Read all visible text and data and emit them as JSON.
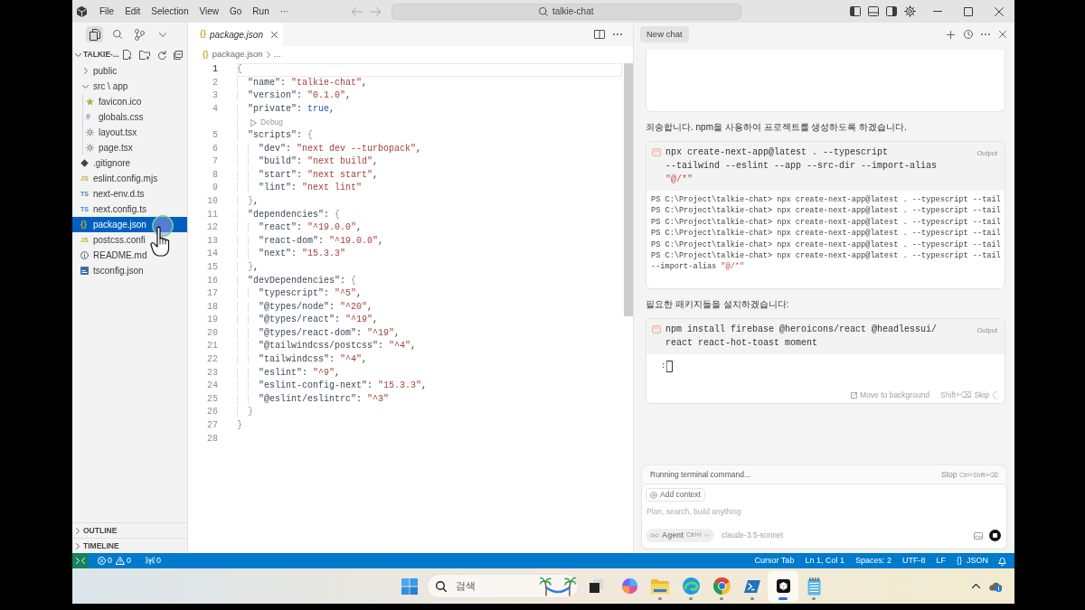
{
  "title_bar": {
    "menu": [
      "File",
      "Edit",
      "Selection",
      "View",
      "Go",
      "Run",
      "···"
    ],
    "command_center": "talkie-chat"
  },
  "activity_bar": [
    {
      "kind": "files",
      "selected": true
    },
    {
      "kind": "search",
      "selected": false
    },
    {
      "kind": "source-control",
      "selected": false
    }
  ],
  "explorer": {
    "title": "TALKIE-...",
    "expanded": true,
    "tree": [
      {
        "label": "public",
        "kind": "folder",
        "expanded": false,
        "selected": false
      },
      {
        "label": "src \\ app",
        "kind": "folder",
        "expanded": true,
        "selected": false,
        "children": [
          {
            "label": "favicon.ico",
            "kind": "star",
            "selected": false
          },
          {
            "label": "globals.css",
            "kind": "css",
            "glyph": "#",
            "selected": false
          },
          {
            "label": "layout.tsx",
            "kind": "gear",
            "selected": false
          },
          {
            "label": "page.tsx",
            "kind": "gear",
            "selected": false
          }
        ]
      },
      {
        "label": ".gitignore",
        "kind": "diamond",
        "selected": false
      },
      {
        "label": "eslint.config.mjs",
        "kind": "js",
        "glyph": "JS",
        "selected": false
      },
      {
        "label": "next-env.d.ts",
        "kind": "ts",
        "glyph": "TS",
        "selected": false
      },
      {
        "label": "next.config.ts",
        "kind": "ts",
        "glyph": "TS",
        "selected": false
      },
      {
        "label": "package.json",
        "kind": "json",
        "glyph": "{}",
        "selected": true
      },
      {
        "label": "postcss.confi",
        "kind": "js",
        "glyph": "JS",
        "selected": false
      },
      {
        "label": "README.md",
        "kind": "info",
        "selected": false
      },
      {
        "label": "tsconfig.json",
        "kind": "tsconfig",
        "selected": false
      }
    ],
    "sections": [
      {
        "label": "OUTLINE",
        "expanded": false
      },
      {
        "label": "TIMELINE",
        "expanded": false
      }
    ]
  },
  "mouse_pointer": {
    "kind": "hand",
    "click_ring": true
  },
  "editor": {
    "tabs": [
      {
        "glyph": "{}",
        "label": "package.json",
        "preview": true,
        "selected": true
      }
    ],
    "breadcrumb": [
      {
        "glyph": "{}",
        "label": "package.json"
      },
      {
        "label": "..."
      }
    ],
    "lines": [
      {
        "kind": "code",
        "number": "1",
        "text": "{",
        "current": true
      },
      {
        "kind": "code",
        "number": "2",
        "text": "  \"name\": \"talkie-chat\",",
        "current": false
      },
      {
        "kind": "code",
        "number": "3",
        "text": "  \"version\": \"0.1.0\",",
        "current": false
      },
      {
        "kind": "code",
        "number": "4",
        "text": "  \"private\": true,",
        "current": false
      },
      {
        "kind": "codelens",
        "text": "Debug"
      },
      {
        "kind": "code",
        "number": "5",
        "text": "  \"scripts\": {",
        "current": false
      },
      {
        "kind": "code",
        "number": "6",
        "text": "    \"dev\": \"next dev --turbopack\",",
        "current": false
      },
      {
        "kind": "code",
        "number": "7",
        "text": "    \"build\": \"next build\",",
        "current": false
      },
      {
        "kind": "code",
        "number": "8",
        "text": "    \"start\": \"next start\",",
        "current": false
      },
      {
        "kind": "code",
        "number": "9",
        "text": "    \"lint\": \"next lint\"",
        "current": false
      },
      {
        "kind": "code",
        "number": "10",
        "text": "  },",
        "current": false
      },
      {
        "kind": "code",
        "number": "11",
        "text": "  \"dependencies\": {",
        "current": false
      },
      {
        "kind": "code",
        "number": "12",
        "text": "    \"react\": \"^19.0.0\",",
        "current": false
      },
      {
        "kind": "code",
        "number": "13",
        "text": "    \"react-dom\": \"^19.0.0\",",
        "current": false
      },
      {
        "kind": "code",
        "number": "14",
        "text": "    \"next\": \"15.3.3\"",
        "current": false
      },
      {
        "kind": "code",
        "number": "15",
        "text": "  },",
        "current": false
      },
      {
        "kind": "code",
        "number": "16",
        "text": "  \"devDependencies\": {",
        "current": false
      },
      {
        "kind": "code",
        "number": "17",
        "text": "    \"typescript\": \"^5\",",
        "current": false
      },
      {
        "kind": "code",
        "number": "18",
        "text": "    \"@types/node\": \"^20\",",
        "current": false
      },
      {
        "kind": "code",
        "number": "19",
        "text": "    \"@types/react\": \"^19\",",
        "current": false
      },
      {
        "kind": "code",
        "number": "20",
        "text": "    \"@types/react-dom\": \"^19\",",
        "current": false
      },
      {
        "kind": "code",
        "number": "21",
        "text": "    \"@tailwindcss/postcss\": \"^4\",",
        "current": false
      },
      {
        "kind": "code",
        "number": "22",
        "text": "    \"tailwindcss\": \"^4\",",
        "current": false
      },
      {
        "kind": "code",
        "number": "23",
        "text": "    \"eslint\": \"^9\",",
        "current": false
      },
      {
        "kind": "code",
        "number": "24",
        "text": "    \"eslint-config-next\": \"15.3.3\",",
        "current": false
      },
      {
        "kind": "code",
        "number": "25",
        "text": "    \"@eslint/eslintrc\": \"^3\"",
        "current": false
      },
      {
        "kind": "code",
        "number": "26",
        "text": "  }",
        "current": false
      },
      {
        "kind": "code",
        "number": "27",
        "text": "}",
        "current": false
      },
      {
        "kind": "code",
        "number": "28",
        "current": false
      }
    ]
  },
  "chat": {
    "tabs": [
      {
        "label": "New chat",
        "selected": true
      }
    ],
    "messages": [
      {
        "kind": "clipped-card"
      },
      {
        "kind": "text",
        "text": "죄송합니다. npm을 사용하여 프로젝트를 생성하도록 하겠습니다."
      },
      {
        "kind": "command",
        "command_lines": [
          "npx create-next-app@latest . --typescript",
          "--tailwind --eslint --app --src-dir --import-alias",
          "\"@/*\""
        ],
        "output_label": "Output",
        "output_lines": [
          "PS C:\\Project\\talkie-chat> npx create-next-app@latest . --typescript --tail",
          "PS C:\\Project\\talkie-chat> npx create-next-app@latest . --typescript --tail",
          "PS C:\\Project\\talkie-chat> npx create-next-app@latest . --typescript --tail",
          "PS C:\\Project\\talkie-chat> npx create-next-app@latest . --typescript --tail",
          "PS C:\\Project\\talkie-chat> npx create-next-app@latest . --typescript --tail",
          "PS C:\\Project\\talkie-chat> npx create-next-app@latest . --typescript --tail",
          "--import-alias \"@/*\""
        ]
      },
      {
        "kind": "text",
        "text": "필요한 패키지들을 설치하겠습니다:"
      },
      {
        "kind": "command",
        "command_lines": [
          "npm install firebase @heroicons/react @headlessui/",
          "react react-hot-toast moment"
        ],
        "output_label": "Output",
        "prompt": ":",
        "actions": {
          "background": "Move to background",
          "skip_shortcut": "Shift+⌫",
          "skip": "Skip"
        }
      }
    ],
    "run_status": {
      "text": "Running terminal command...",
      "stop": "Stop",
      "stop_shortcut": "Ctrl+Shift+⌫"
    },
    "composer": {
      "context_chip": "Add context",
      "placeholder": "Plan, search, build anything",
      "mode": "Agent",
      "mode_shortcut": "Ctrl+I",
      "model": "claude-3.5-sonnet"
    }
  },
  "status_bar": {
    "problems": {
      "errors": "0",
      "warnings": "0"
    },
    "ports": "0",
    "items": [
      {
        "label": "Cursor Tab"
      },
      {
        "label": "Ln 1, Col 1"
      },
      {
        "label": "Spaces: 2"
      },
      {
        "label": "UTF-8"
      },
      {
        "label": "LF"
      },
      {
        "glyph": "{}",
        "label": "JSON"
      }
    ]
  },
  "taskbar": {
    "search": {
      "placeholder": "검색"
    },
    "apps": [
      {
        "kind": "task-view",
        "running": false,
        "selected": false
      },
      {
        "kind": "swirl",
        "running": false,
        "selected": false
      },
      {
        "kind": "folder",
        "running": true,
        "selected": false
      },
      {
        "kind": "wave",
        "running": true,
        "selected": false
      },
      {
        "kind": "ring",
        "running": true,
        "selected": false
      },
      {
        "kind": "terminal",
        "running": true,
        "selected": false
      },
      {
        "kind": "cube",
        "running": true,
        "selected": true
      },
      {
        "kind": "notepad",
        "running": true,
        "selected": false
      }
    ]
  }
}
